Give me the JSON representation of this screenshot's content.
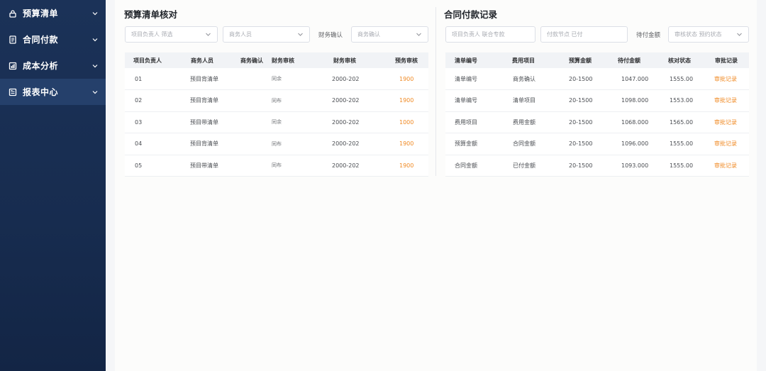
{
  "sidebar": {
    "items": [
      {
        "label": "预算清单",
        "icon": "lock-icon"
      },
      {
        "label": "合同付款",
        "icon": "document-icon"
      },
      {
        "label": "成本分析",
        "icon": "calculator-icon"
      },
      {
        "label": "报表中心",
        "icon": "report-icon"
      }
    ],
    "active_index": 3
  },
  "left": {
    "title": "预算清单核对",
    "filters": {
      "owner_placeholder": "项目负责人 筛选",
      "business_placeholder": "商务人员",
      "confirm_label": "财务确认",
      "confirm_placeholder": "商务确认"
    },
    "columns": [
      "项目负责人",
      "商务人员",
      "商务确认",
      "财务审核",
      "财务审核",
      "预务审核"
    ],
    "rows": [
      {
        "c1": "01",
        "c2": "预目背清单",
        "c3": "同余",
        "c4": "2000-202",
        "c5": "1900"
      },
      {
        "c1": "02",
        "c2": "预目背清单",
        "c3": "同布",
        "c4": "2000-202",
        "c5": "1900"
      },
      {
        "c1": "03",
        "c2": "预目带清单",
        "c3": "同余",
        "c4": "2000-202",
        "c5": "1000"
      },
      {
        "c1": "04",
        "c2": "预目背清单",
        "c3": "同布",
        "c4": "2000-202",
        "c5": "1900"
      },
      {
        "c1": "05",
        "c2": "预目带清单",
        "c3": "同布",
        "c4": "2000-202",
        "c5": "1900"
      }
    ]
  },
  "right": {
    "title": "合同付款记录",
    "filters": {
      "owner_placeholder": "项目负责人 联合专款",
      "node_placeholder": "付款节点 已付",
      "amount_label": "待付金额",
      "amount_placeholder": "审核状态 预约状态"
    },
    "columns": [
      "清单编号",
      "费用项目",
      "预算金额",
      "待付金额",
      "核对状态",
      "审批记录"
    ],
    "rows": [
      {
        "c1": "清单编号",
        "c2": "商务确认",
        "c3": "20-1500",
        "c4": "1047.000",
        "c5": "1555.00",
        "c6": "审批记录"
      },
      {
        "c1": "清单编号",
        "c2": "清单项目",
        "c3": "20-1500",
        "c4": "1098.000",
        "c5": "1553.00",
        "c6": "审批记录"
      },
      {
        "c1": "费用项目",
        "c2": "费用金额",
        "c3": "20-1500",
        "c4": "1068.000",
        "c5": "1565.00",
        "c6": "审批记录"
      },
      {
        "c1": "预算金额",
        "c2": "合同金额",
        "c3": "20-1500",
        "c4": "1096.000",
        "c5": "1555.00",
        "c6": "审批记录"
      },
      {
        "c1": "合同金额",
        "c2": "已付金额",
        "c3": "20-1500",
        "c4": "1093.000",
        "c5": "1555.00",
        "c6": "审批记录"
      }
    ]
  }
}
